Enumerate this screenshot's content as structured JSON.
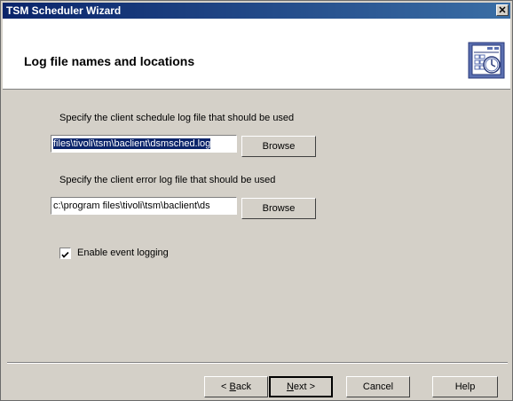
{
  "window": {
    "title": "TSM Scheduler Wizard",
    "close_label": "✕"
  },
  "header": {
    "heading": "Log file names and locations",
    "icon": "calendar-clock-icon"
  },
  "schedule_log": {
    "label": "Specify the client schedule log file that should be used",
    "value": "files\\tivoli\\tsm\\baclient\\dsmsched.log",
    "browse_label": "Browse"
  },
  "error_log": {
    "label": "Specify the client error log file that should be used",
    "value": "c:\\program files\\tivoli\\tsm\\baclient\\ds",
    "browse_label": "Browse"
  },
  "event_logging": {
    "label": "Enable event logging",
    "checked": true
  },
  "footer": {
    "back_accel": "B",
    "back_rest": "ack",
    "back_prefix": "< ",
    "next_accel": "N",
    "next_rest": "ext >",
    "cancel_label": "Cancel",
    "help_label": "Help"
  },
  "colors": {
    "title_start": "#0a246a",
    "title_end": "#3a6ea5",
    "face": "#d4d0c8",
    "header_bg": "#ffffff",
    "icon_blue": "#5a6fb0"
  }
}
